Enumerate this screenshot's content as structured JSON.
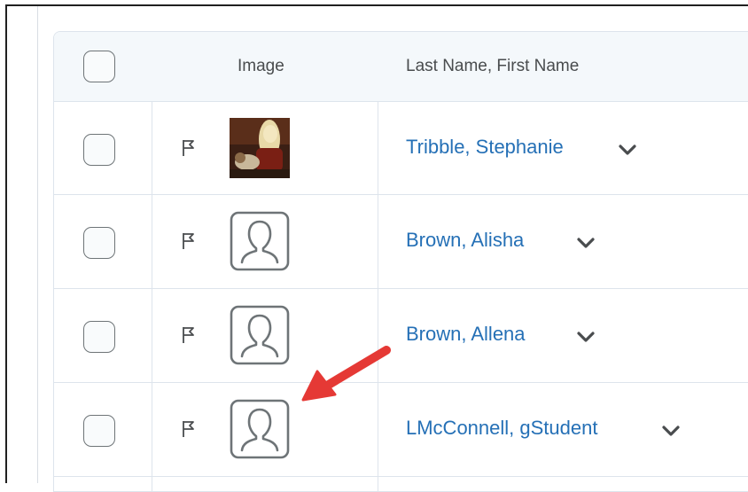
{
  "table": {
    "headers": {
      "image": "Image",
      "name": "Last Name, First Name"
    },
    "rows": [
      {
        "name": "Tribble, Stephanie",
        "has_photo": true
      },
      {
        "name": "Brown, Alisha",
        "has_photo": false
      },
      {
        "name": "Brown, Allena",
        "has_photo": false
      },
      {
        "name": "LMcConnell, gStudent",
        "has_photo": false
      }
    ]
  },
  "icons": {
    "flag": "flag-icon",
    "avatar": "user-avatar-icon",
    "chevron": "chevron-down-icon",
    "annotation": "red-arrow-icon"
  },
  "colors": {
    "link": "#2570b6",
    "header_bg": "#f4f8fb",
    "annotation_arrow": "#e53935"
  }
}
